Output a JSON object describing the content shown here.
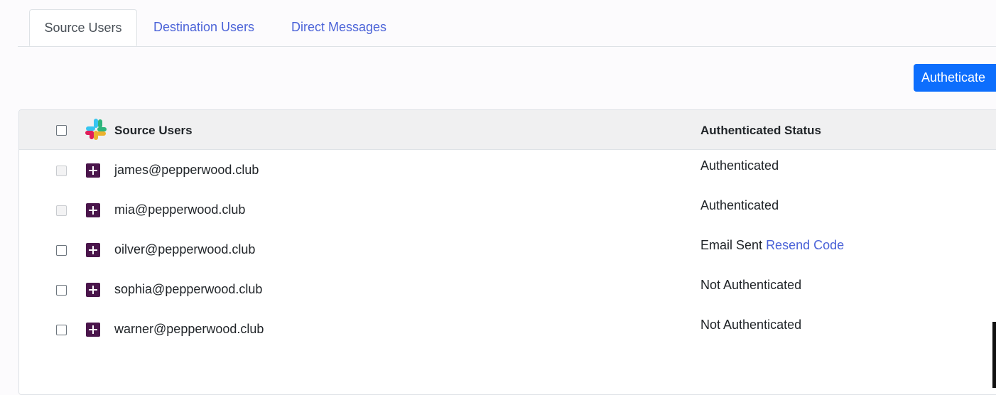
{
  "tabs": [
    {
      "label": "Source Users",
      "active": true
    },
    {
      "label": "Destination Users",
      "active": false
    },
    {
      "label": "Direct Messages",
      "active": false
    }
  ],
  "toolbar": {
    "authenticate_label": "Autheticate"
  },
  "table": {
    "headers": {
      "source_users": "Source Users",
      "status": "Authenticated Status"
    },
    "rows": [
      {
        "email": "james@pepperwood.club",
        "status": "Authenticated",
        "action": "",
        "checkbox_disabled": true
      },
      {
        "email": "mia@pepperwood.club",
        "status": "Authenticated",
        "action": "",
        "checkbox_disabled": true
      },
      {
        "email": "oilver@pepperwood.club",
        "status": "Email Sent",
        "action": "Resend Code",
        "checkbox_disabled": false
      },
      {
        "email": "sophia@pepperwood.club",
        "status": "Not Authenticated",
        "action": "",
        "checkbox_disabled": false
      },
      {
        "email": "warner@pepperwood.club",
        "status": "Not Authenticated",
        "action": "",
        "checkbox_disabled": false
      }
    ]
  },
  "icons": {
    "header": "slack-logo-icon",
    "row": "slack-icon"
  },
  "colors": {
    "accent": "#0d6efd",
    "link": "#4b63d8",
    "slack_purple": "#4a154b"
  }
}
